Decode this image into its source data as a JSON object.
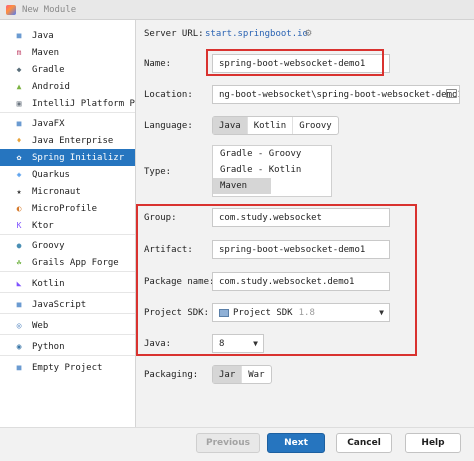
{
  "window": {
    "title": "New Module"
  },
  "sidebar": {
    "items": [
      {
        "label": "Java",
        "icon": "folder-icon",
        "color": "#6b9bd1"
      },
      {
        "label": "Maven",
        "icon": "maven-icon",
        "color": "#c1456a"
      },
      {
        "label": "Gradle",
        "icon": "gradle-icon",
        "color": "#5a6e7a"
      },
      {
        "label": "Android",
        "icon": "android-icon",
        "color": "#7cb342"
      },
      {
        "label": "IntelliJ Platform Plugin",
        "icon": "plugin-icon",
        "color": "#6b7580"
      },
      {
        "label": "JavaFX",
        "icon": "folder-icon",
        "color": "#6b9bd1"
      },
      {
        "label": "Java Enterprise",
        "icon": "enterprise-icon",
        "color": "#e8a33b"
      },
      {
        "label": "Spring Initializr",
        "icon": "spring-icon",
        "color": "#6cb33f"
      },
      {
        "label": "Quarkus",
        "icon": "quarkus-icon",
        "color": "#4695eb"
      },
      {
        "label": "Micronaut",
        "icon": "micronaut-icon",
        "color": "#333333"
      },
      {
        "label": "MicroProfile",
        "icon": "microprofile-icon",
        "color": "#d67a2b"
      },
      {
        "label": "Ktor",
        "icon": "ktor-icon",
        "color": "#7f52ff"
      },
      {
        "label": "Groovy",
        "icon": "groovy-icon",
        "color": "#4a8fb4"
      },
      {
        "label": "Grails App Forge",
        "icon": "grails-icon",
        "color": "#79b84e"
      },
      {
        "label": "Kotlin",
        "icon": "kotlin-icon",
        "color": "#7f52ff"
      },
      {
        "label": "JavaScript",
        "icon": "javascript-icon",
        "color": "#6b9bd1"
      },
      {
        "label": "Web",
        "icon": "globe-icon",
        "color": "#4a7fbd"
      },
      {
        "label": "Python",
        "icon": "python-icon",
        "color": "#3b77a8"
      },
      {
        "label": "Empty Project",
        "icon": "folder-icon",
        "color": "#6b9bd1"
      }
    ],
    "selected": "Spring Initializr"
  },
  "form": {
    "server_url_label": "Server URL:",
    "server_url": "start.springboot.io",
    "name_label": "Name:",
    "name": "spring-boot-websocket-demo1",
    "location_label": "Location:",
    "location": "ng-boot-websocket\\spring-boot-websocket-demo1",
    "language_label": "Language:",
    "languages": [
      "Java",
      "Kotlin",
      "Groovy"
    ],
    "language_selected": "Java",
    "type_label": "Type:",
    "types": [
      "Gradle - Groovy",
      "Gradle - Kotlin",
      "Maven"
    ],
    "type_selected": "Maven",
    "group_label": "Group:",
    "group": "com.study.websocket",
    "artifact_label": "Artifact:",
    "artifact": "spring-boot-websocket-demo1",
    "package_label": "Package name:",
    "package": "com.study.websocket.demo1",
    "sdk_label": "Project SDK:",
    "sdk": "Project SDK",
    "sdk_version": "1.8",
    "java_label": "Java:",
    "java": "8",
    "packaging_label": "Packaging:",
    "packagings": [
      "Jar",
      "War"
    ],
    "packaging_selected": "Jar"
  },
  "buttons": {
    "previous": "Previous",
    "next": "Next",
    "cancel": "Cancel",
    "help": "Help"
  },
  "colors": {
    "accent": "#2675bf",
    "highlight_box": "#d9322f"
  }
}
